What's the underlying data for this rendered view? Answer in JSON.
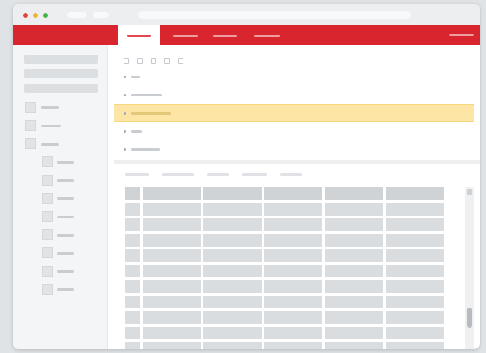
{
  "window": {
    "title": "",
    "address": ""
  },
  "app": {
    "accent_color": "#d9262e",
    "highlight_color": "#fde5a6",
    "tabs": [
      {
        "label": "",
        "active": true
      },
      {
        "label": "",
        "active": false
      },
      {
        "label": "",
        "active": false
      },
      {
        "label": "",
        "active": false
      }
    ],
    "user": ""
  },
  "sidebar": {
    "inputs": [
      "",
      "",
      ""
    ],
    "items": [
      {
        "label": "",
        "level": 0,
        "icon": "folder-icon"
      },
      {
        "label": "",
        "level": 0,
        "icon": "folder-icon"
      },
      {
        "label": "",
        "level": 0,
        "icon": "folder-icon"
      },
      {
        "label": "",
        "level": 1,
        "icon": "folder-icon"
      },
      {
        "label": "",
        "level": 1,
        "icon": "folder-icon"
      },
      {
        "label": "",
        "level": 1,
        "icon": "folder-icon"
      },
      {
        "label": "",
        "level": 1,
        "icon": "folder-icon"
      },
      {
        "label": "",
        "level": 1,
        "icon": "folder-icon"
      },
      {
        "label": "",
        "level": 1,
        "icon": "folder-icon"
      },
      {
        "label": "",
        "level": 1,
        "icon": "folder-icon"
      },
      {
        "label": "",
        "level": 1,
        "icon": "folder-icon"
      }
    ]
  },
  "toolbar": {
    "icons": [
      "tool-icon",
      "tool-icon",
      "tool-icon",
      "tool-icon",
      "tool-icon"
    ]
  },
  "outline": {
    "selected_index": 2,
    "items": [
      {
        "label": ""
      },
      {
        "label": ""
      },
      {
        "label": ""
      },
      {
        "label": ""
      },
      {
        "label": ""
      }
    ]
  },
  "filters": [
    "",
    "",
    "",
    "",
    ""
  ],
  "table": {
    "columns": [
      "",
      "",
      "",
      "",
      "",
      ""
    ],
    "row_count": 10
  }
}
